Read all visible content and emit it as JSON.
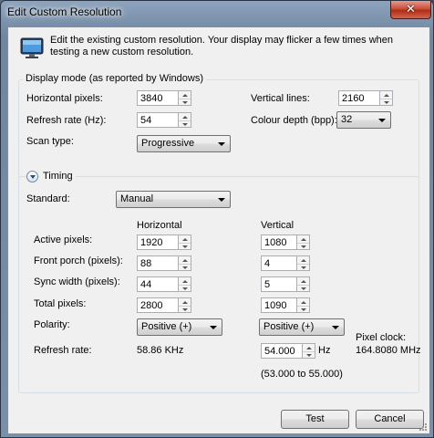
{
  "window": {
    "title": "Edit Custom Resolution",
    "close_glyph": "✕"
  },
  "description": "Edit the existing custom resolution. Your display may flicker a few times when testing a new custom resolution.",
  "display_mode": {
    "label": "Display mode (as reported by Windows)",
    "horizontal_pixels": {
      "label": "Horizontal pixels:",
      "value": "3840"
    },
    "vertical_lines": {
      "label": "Vertical lines:",
      "value": "2160"
    },
    "refresh_rate": {
      "label": "Refresh rate (Hz):",
      "value": "54"
    },
    "colour_depth": {
      "label": "Colour depth (bpp):",
      "value": "32"
    },
    "scan_type": {
      "label": "Scan type:",
      "value": "Progressive"
    }
  },
  "timing": {
    "label": "Timing",
    "standard": {
      "label": "Standard:",
      "value": "Manual"
    },
    "col_horizontal": "Horizontal",
    "col_vertical": "Vertical",
    "rows": {
      "active": {
        "label": "Active pixels:",
        "h": "1920",
        "v": "1080"
      },
      "front_porch": {
        "label": "Front porch (pixels):",
        "h": "88",
        "v": "4"
      },
      "sync_width": {
        "label": "Sync width (pixels):",
        "h": "44",
        "v": "5"
      },
      "total": {
        "label": "Total pixels:",
        "h": "2800",
        "v": "1090"
      }
    },
    "polarity": {
      "label": "Polarity:",
      "h": "Positive (+)",
      "v": "Positive (+)"
    },
    "refresh": {
      "label": "Refresh rate:",
      "h_value": "58.86 KHz",
      "v_value": "54.000",
      "v_unit": "Hz",
      "range": "(53.000 to 55.000)"
    },
    "pixel_clock": {
      "label": "Pixel clock:",
      "value": "164.8080 MHz"
    }
  },
  "buttons": {
    "test": "Test",
    "cancel": "Cancel"
  },
  "colors": {
    "accent": "#3c7fb1",
    "close": "#c9503d",
    "dialog_bg": "#f0f0f0"
  },
  "icons": {
    "app": "monitor-icon",
    "expander": "chevron-down-icon",
    "close": "close-icon"
  }
}
